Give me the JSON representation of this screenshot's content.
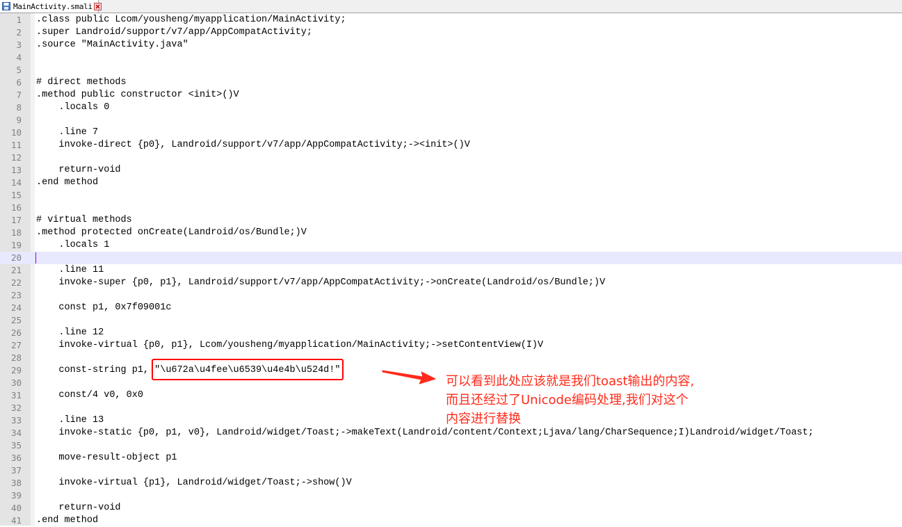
{
  "tab": {
    "filename": "MainActivity.smali",
    "icon": "save-file-icon",
    "close_icon": "close-icon"
  },
  "lines": [
    ".class public Lcom/yousheng/myapplication/MainActivity;",
    ".super Landroid/support/v7/app/AppCompatActivity;",
    ".source \"MainActivity.java\"",
    "",
    "",
    "# direct methods",
    ".method public constructor <init>()V",
    "    .locals 0",
    "",
    "    .line 7",
    "    invoke-direct {p0}, Landroid/support/v7/app/AppCompatActivity;-><init>()V",
    "",
    "    return-void",
    ".end method",
    "",
    "",
    "# virtual methods",
    ".method protected onCreate(Landroid/os/Bundle;)V",
    "    .locals 1",
    "",
    "    .line 11",
    "    invoke-super {p0, p1}, Landroid/support/v7/app/AppCompatActivity;->onCreate(Landroid/os/Bundle;)V",
    "",
    "    const p1, 0x7f09001c",
    "",
    "    .line 12",
    "    invoke-virtual {p0, p1}, Lcom/yousheng/myapplication/MainActivity;->setContentView(I)V",
    "",
    "    const-string p1, \"\\u672a\\u4fee\\u6539\\u4e4b\\u524d!\"",
    "",
    "    const/4 v0, 0x0",
    "",
    "    .line 13",
    "    invoke-static {p0, p1, v0}, Landroid/widget/Toast;->makeText(Landroid/content/Context;Ljava/lang/CharSequence;I)Landroid/widget/Toast;",
    "",
    "    move-result-object p1",
    "",
    "    invoke-virtual {p1}, Landroid/widget/Toast;->show()V",
    "",
    "    return-void",
    ".end method"
  ],
  "current_line": 20,
  "highlight_line": 29,
  "highlight_text": "\"\\u672a\\u4fee\\u6539\\u4e4b\\u524d!\"",
  "annotation": {
    "lines": [
      "可以看到此处应该就是我们toast输出的内容,",
      "而且还经过了Unicode编码处理,我们对这个",
      "内容进行替换"
    ],
    "color": "#ff2a1a"
  },
  "colors": {
    "highlight_box": "#ff0000",
    "current_line_bg": "#e8e8ff",
    "gutter_bg": "#e4e4e4"
  }
}
